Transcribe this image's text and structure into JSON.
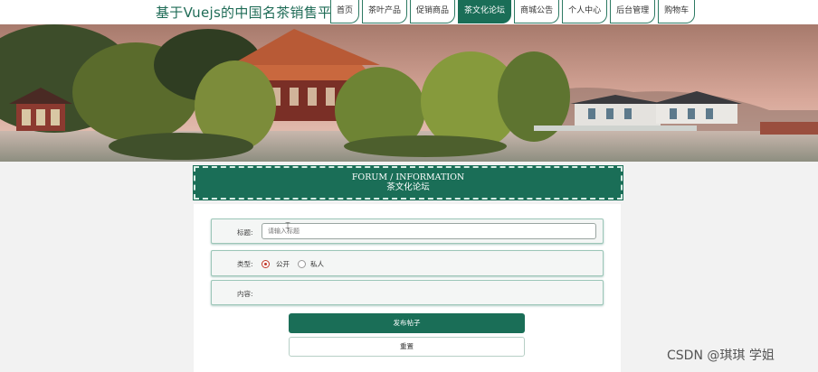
{
  "header": {
    "site_title": "基于Vuejs的中国名茶销售平台",
    "nav": [
      {
        "label": "首页",
        "active": false
      },
      {
        "label": "茶叶产品",
        "active": false
      },
      {
        "label": "促销商品",
        "active": false
      },
      {
        "label": "茶文化论坛",
        "active": true
      },
      {
        "label": "商城公告",
        "active": false
      },
      {
        "label": "个人中心",
        "active": false
      },
      {
        "label": "后台管理",
        "active": false
      },
      {
        "label": "购物车",
        "active": false
      }
    ]
  },
  "banner": {
    "slide_count": 3,
    "active_slide": 1
  },
  "section": {
    "title_en": "FORUM / INFORMATION",
    "title_cn": "茶文化论坛"
  },
  "form": {
    "title_label": "标题:",
    "title_placeholder": "请输入标题",
    "title_value": "",
    "type_label": "类型:",
    "type_options": [
      {
        "label": "公开",
        "selected": true
      },
      {
        "label": "私人",
        "selected": false
      }
    ],
    "content_label": "内容:",
    "submit_label": "发布帖子",
    "reset_label": "重置"
  },
  "watermark": "CSDN @琪琪 学姐",
  "colors": {
    "brand": "#1a6e57",
    "accent": "#38c4a8",
    "radio_checked": "#c0392b"
  }
}
